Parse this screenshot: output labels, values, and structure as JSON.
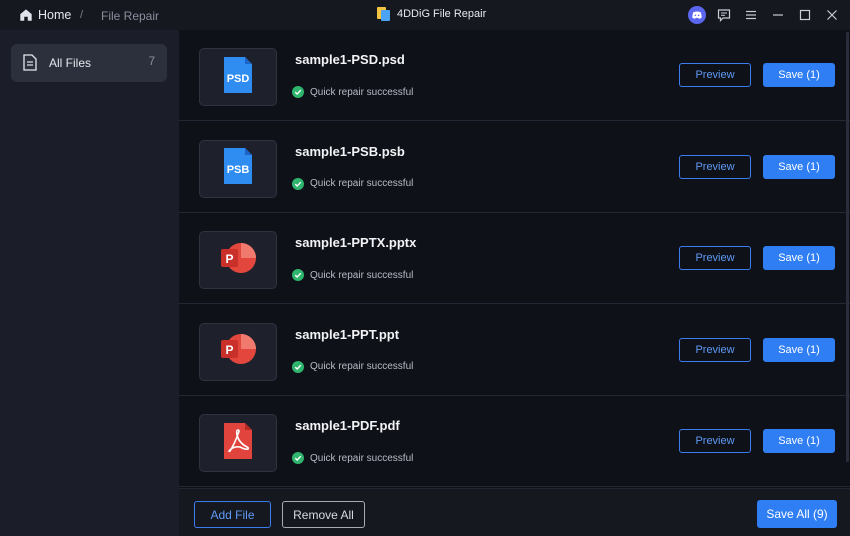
{
  "titlebar": {
    "home_label": "Home",
    "separator": "/",
    "current_page": "File Repair",
    "app_title": "4DDiG File Repair"
  },
  "sidebar": {
    "items": [
      {
        "label": "All Files",
        "count": "7"
      }
    ]
  },
  "files": [
    {
      "name": "sample1-PSD.psd",
      "type": "psd",
      "icon_text": "PSD",
      "status": "Quick repair successful",
      "preview_label": "Preview",
      "save_label": "Save (1)"
    },
    {
      "name": "sample1-PSB.psb",
      "type": "psb",
      "icon_text": "PSB",
      "status": "Quick repair successful",
      "preview_label": "Preview",
      "save_label": "Save (1)"
    },
    {
      "name": "sample1-PPTX.pptx",
      "type": "pptx",
      "icon_text": "P",
      "status": "Quick repair successful",
      "preview_label": "Preview",
      "save_label": "Save (1)"
    },
    {
      "name": "sample1-PPT.ppt",
      "type": "ppt",
      "icon_text": "P",
      "status": "Quick repair successful",
      "preview_label": "Preview",
      "save_label": "Save (1)"
    },
    {
      "name": "sample1-PDF.pdf",
      "type": "pdf",
      "icon_text": "",
      "status": "Quick repair successful",
      "preview_label": "Preview",
      "save_label": "Save (1)"
    }
  ],
  "footer": {
    "add_file_label": "Add File",
    "remove_all_label": "Remove All",
    "save_all_label": "Save All (9)"
  },
  "colors": {
    "accent": "#2f7ef4",
    "success": "#2fb56d",
    "photoshop_blue": "#2f8cf0",
    "powerpoint_red": "#e3463d",
    "pdf_red": "#e0443c"
  }
}
